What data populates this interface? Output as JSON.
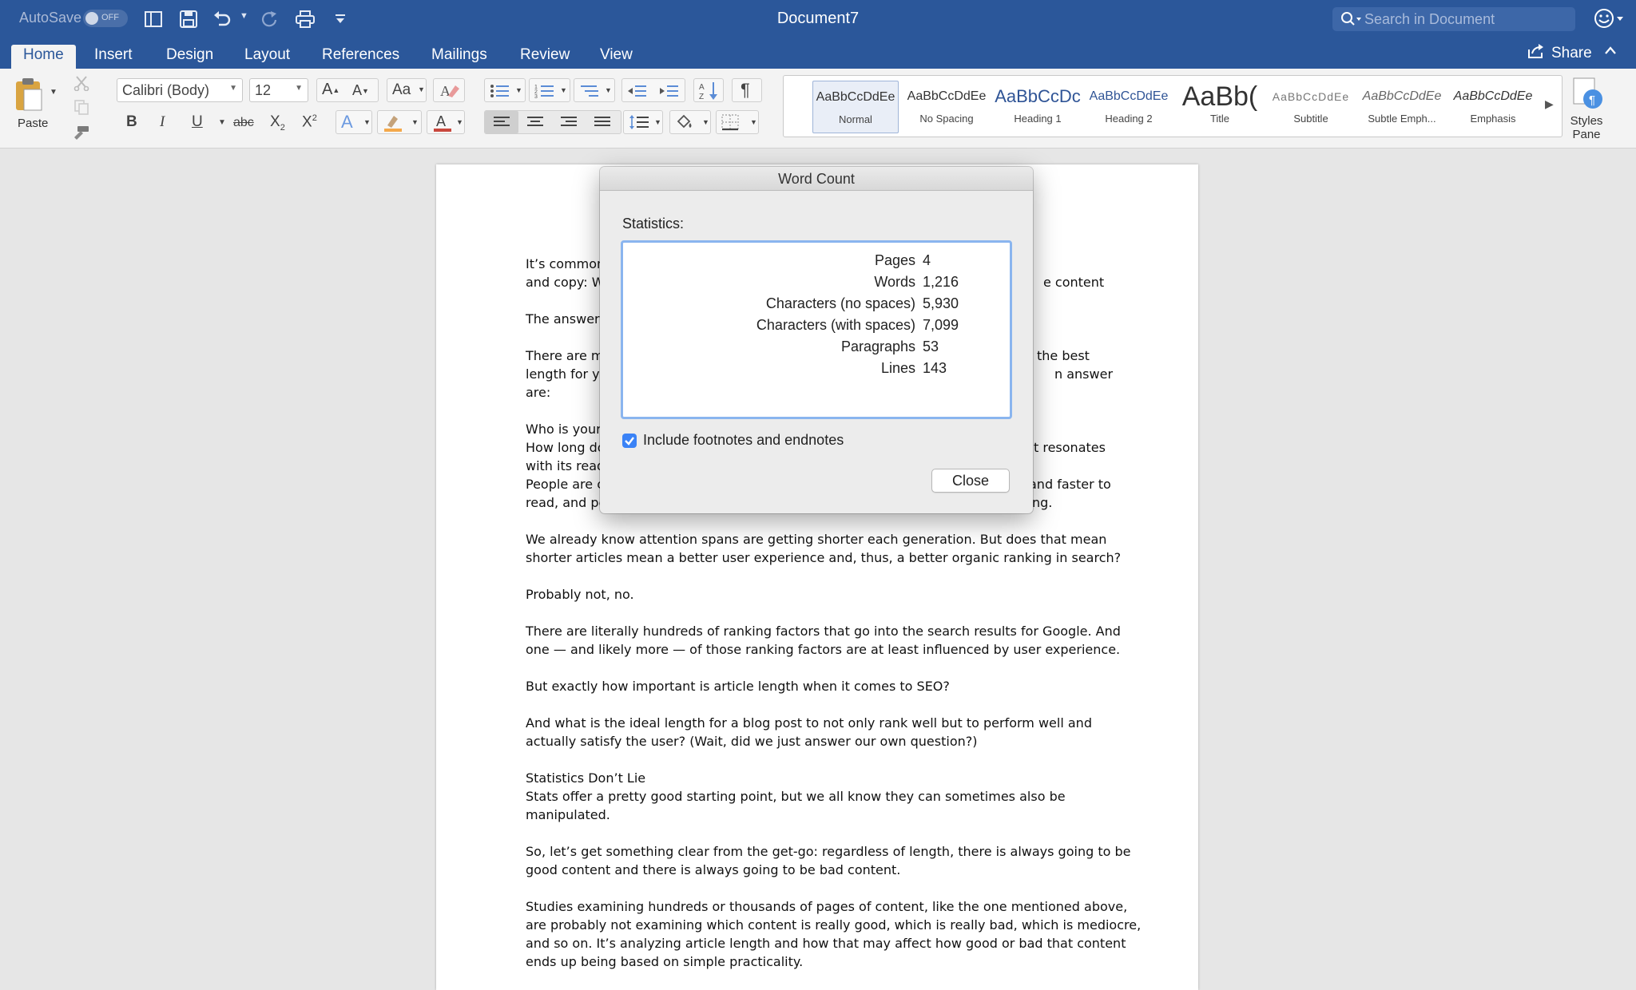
{
  "titlebar": {
    "autosave_label": "AutoSave",
    "autosave_state": "OFF",
    "document_title": "Document7",
    "search_placeholder": "Search in Document"
  },
  "tabs": [
    "Home",
    "Insert",
    "Design",
    "Layout",
    "References",
    "Mailings",
    "Review",
    "View"
  ],
  "active_tab": "Home",
  "share_label": "Share",
  "ribbon": {
    "paste_label": "Paste",
    "font_name": "Calibri (Body)",
    "font_size": "12",
    "styles": [
      {
        "sample": "AaBbCcDdEe",
        "name": "Normal"
      },
      {
        "sample": "AaBbCcDdEe",
        "name": "No Spacing"
      },
      {
        "sample": "AaBbCcDc",
        "name": "Heading 1"
      },
      {
        "sample": "AaBbCcDdEe",
        "name": "Heading 2"
      },
      {
        "sample": "AaBb(",
        "name": "Title"
      },
      {
        "sample": "AaBbCcDdEe",
        "name": "Subtitle"
      },
      {
        "sample": "AaBbCcDdEe",
        "name": "Subtle Emph..."
      },
      {
        "sample": "AaBbCcDdEe",
        "name": "Emphasis"
      }
    ],
    "styles_pane_label_1": "Styles",
    "styles_pane_label_2": "Pane"
  },
  "document": {
    "lines": [
      "It’s common",
      "and copy: W",
      "The answer",
      "There are m",
      "length for yo",
      "are:",
      "Who is your",
      "How long do",
      "with its read",
      "People are c",
      "read, and pe",
      "We already know attention spans are getting shorter each generation. But does that mean",
      "shorter articles mean a better user experience and, thus, a better organic ranking in search?",
      "Probably not, no.",
      "There are literally hundreds of ranking factors that go into the search results for Google. And",
      "one — and likely more — of those ranking factors are at least influenced by user experience.",
      "But exactly how important is article length when it comes to SEO?",
      "And what is the ideal length for a blog post to not only rank well but to perform well and",
      "actually satisfy the user? (Wait, did we just answer our own question?)",
      "Statistics Don’t Lie",
      "Stats offer a pretty good starting point, but we all know they can sometimes also be",
      "manipulated.",
      "So, let’s get something clear from the get-go: regardless of length, there is always going to be",
      "good content and there is always going to be bad content.",
      "Studies examining hundreds or thousands of pages of content, like the one mentioned above,",
      "are probably not examining which content is really good, which is really bad, which is mediocre,",
      "and so on. It’s analyzing article length and how that may affect how good or bad that content",
      "ends up being based on simple practicality."
    ],
    "right_fragments": [
      "e content",
      "the best",
      "n answer",
      "t resonates",
      "and faster to",
      "ng."
    ]
  },
  "dialog": {
    "title": "Word Count",
    "statistics_label": "Statistics:",
    "stats": [
      {
        "label": "Pages",
        "value": "4"
      },
      {
        "label": "Words",
        "value": "1,216"
      },
      {
        "label": "Characters (no spaces)",
        "value": "5,930"
      },
      {
        "label": "Characters (with spaces)",
        "value": "7,099"
      },
      {
        "label": "Paragraphs",
        "value": "53"
      },
      {
        "label": "Lines",
        "value": "143"
      }
    ],
    "include_footnotes_label": "Include footnotes and endnotes",
    "include_footnotes_checked": true,
    "close_label": "Close"
  },
  "colors": {
    "titlebar_blue": "#2b579a",
    "focus_ring": "#8ab5ef",
    "checkbox_blue": "#3a82f6"
  }
}
